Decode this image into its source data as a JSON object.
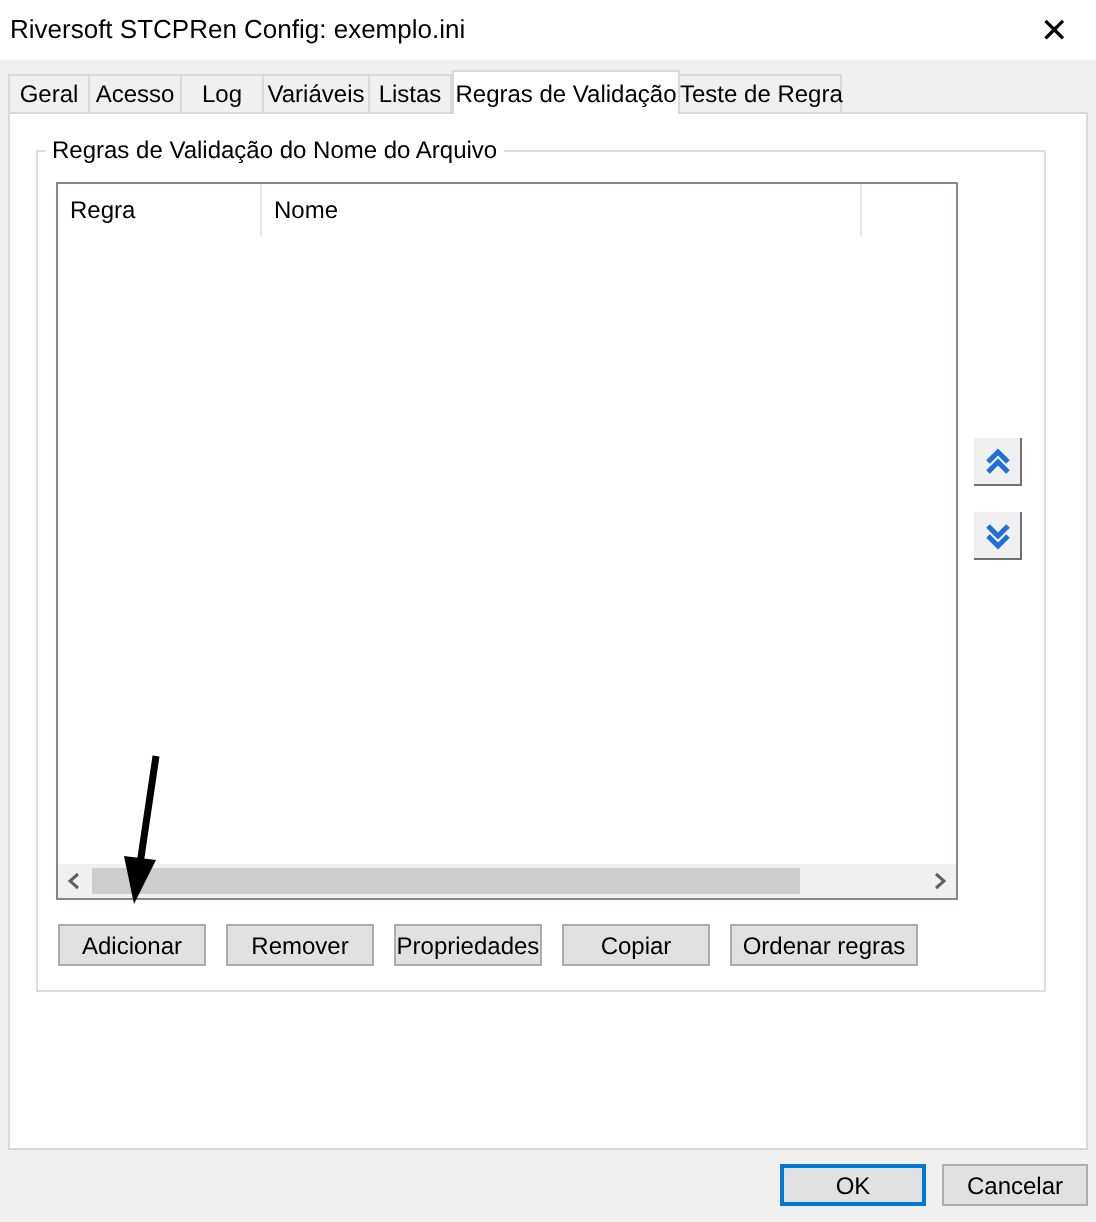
{
  "window": {
    "title": "Riversoft STCPRen Config: exemplo.ini",
    "close": "✕"
  },
  "tabs": [
    {
      "label": "Geral",
      "selected": false
    },
    {
      "label": "Acesso",
      "selected": false
    },
    {
      "label": "Log",
      "selected": false
    },
    {
      "label": "Variáveis",
      "selected": false
    },
    {
      "label": "Listas",
      "selected": false
    },
    {
      "label": "Regras de Validação",
      "selected": true
    },
    {
      "label": "Teste de Regra",
      "selected": false
    }
  ],
  "group": {
    "title": "Regras de Validação do Nome do Arquivo",
    "table": {
      "columns": [
        "Regra",
        "Nome"
      ]
    },
    "buttons": [
      "Adicionar",
      "Remover",
      "Propriedades",
      "Copiar",
      "Ordenar regras"
    ]
  },
  "footer": [
    {
      "label": "OK",
      "default": true
    },
    {
      "label": "Cancelar",
      "default": false
    }
  ]
}
